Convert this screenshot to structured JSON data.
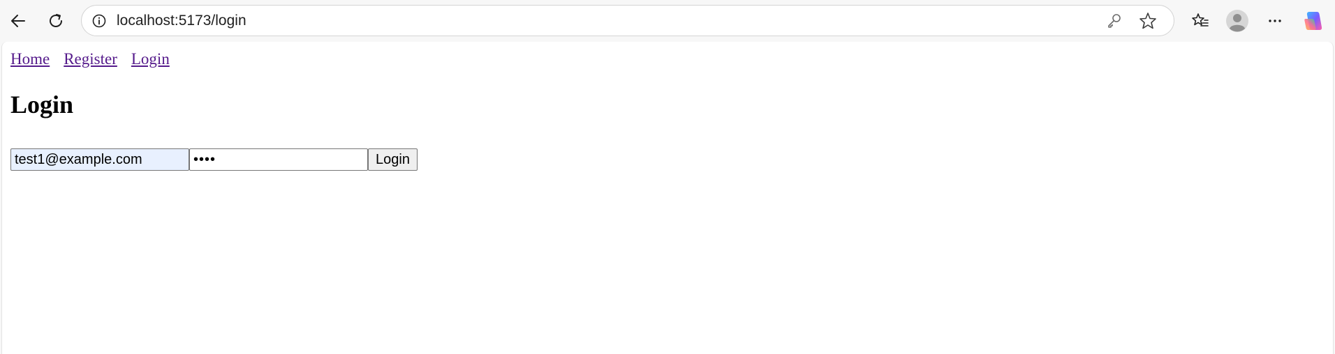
{
  "browser": {
    "url": "localhost:5173/login",
    "icons": {
      "back": "back-arrow-icon",
      "refresh": "refresh-icon",
      "site_info": "info-icon",
      "password_key": "key-icon",
      "favorite": "star-icon",
      "favorites_list": "favorites-icon",
      "profile": "profile-avatar-icon",
      "more": "more-options-icon",
      "copilot": "copilot-icon"
    }
  },
  "nav": {
    "home": "Home",
    "register": "Register",
    "login": "Login"
  },
  "page": {
    "heading": "Login"
  },
  "form": {
    "email_value": "test1@example.com",
    "password_value": "••••",
    "submit_label": "Login"
  },
  "colors": {
    "link": "#551a8b",
    "autofill_bg": "#e8f0fe",
    "chrome_bg": "#f7f7f7"
  }
}
